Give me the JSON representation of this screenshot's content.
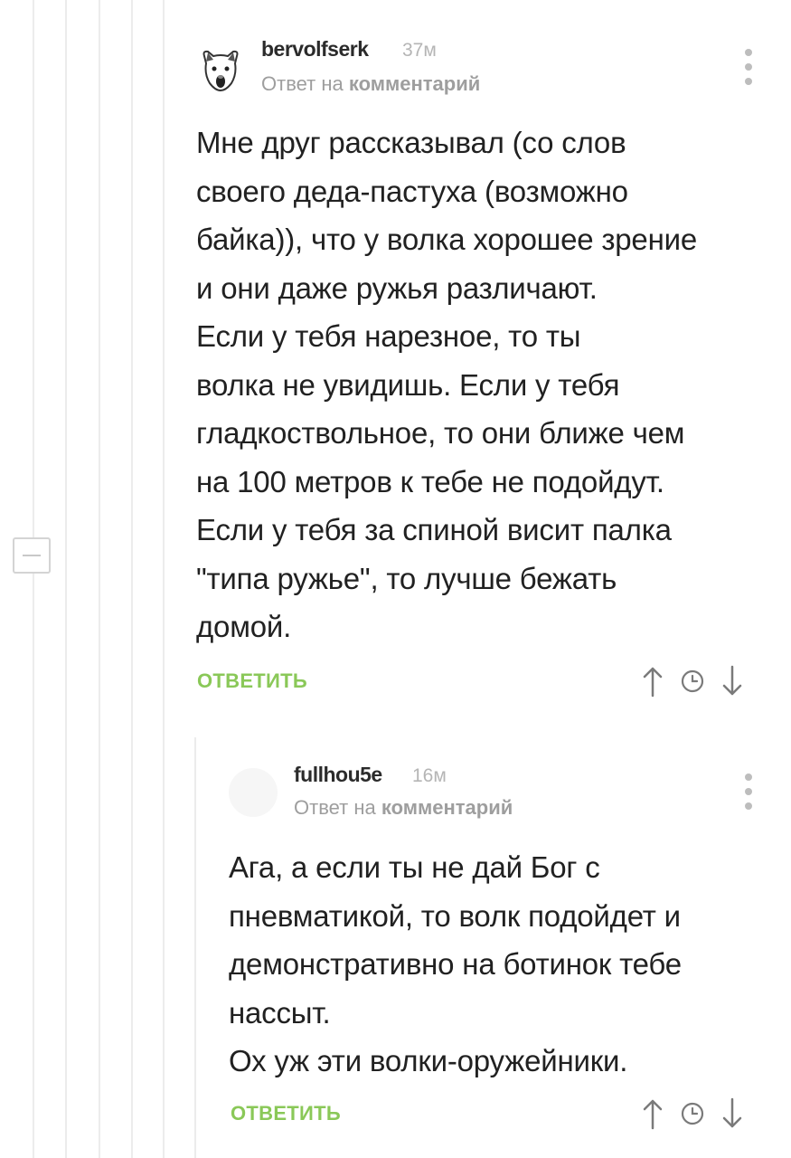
{
  "comments": [
    {
      "username": "bervolfserk",
      "time": "37м",
      "reply_prefix": "Ответ на",
      "reply_target": "комментарий",
      "avatar_icon": "wolf-avatar-icon",
      "lines": [
        "Мне друг рассказывал (со слов",
        "своего деда-пастуха (возможно",
        "байка)), что у волка хорошее зрение",
        "и они даже ружья различают.",
        "Если у тебя нарезное, то ты",
        "волка не увидишь. Если у тебя",
        "гладкоствольное, то они ближе чем",
        "на 100 метров к тебе не подойдут.",
        "Если у тебя за спиной висит палка",
        "\"типа ружье\", то лучше бежать",
        "домой."
      ],
      "reply_label": "ОТВЕТИТЬ"
    },
    {
      "username": "fullhou5e",
      "time": "16м",
      "reply_prefix": "Ответ на",
      "reply_target": "комментарий",
      "avatar_icon": "default-avatar-icon",
      "lines": [
        "Ага, а если ты не дай Бог с",
        "пневматикой, то волк подойдет и",
        "демонстративно на ботинок тебе",
        "нассыт.",
        "Ох уж эти волки-оружейники."
      ],
      "reply_label": "ОТВЕТИТЬ"
    }
  ],
  "icons": {
    "vote_up": "arrow-up-icon",
    "save": "clock-icon",
    "vote_down": "arrow-down-icon",
    "menu": "more-vertical-icon",
    "collapse": "collapse-minus-icon"
  },
  "colors": {
    "accent_green": "#8ac858",
    "thread_line": "#ececec",
    "meta_gray": "#9e9e9e"
  }
}
